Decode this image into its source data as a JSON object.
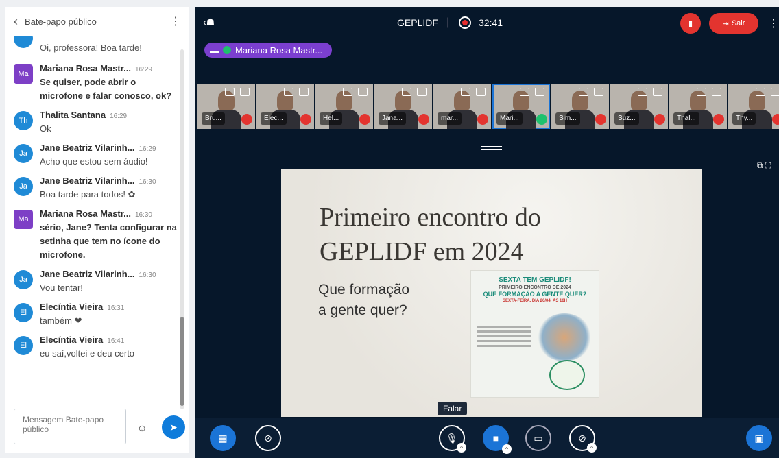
{
  "chat": {
    "title": "Bate-papo público",
    "partial_message": "Oi, professora! Boa tarde!",
    "messages": [
      {
        "initials": "Ma",
        "author": "Mariana Rosa Mastr...",
        "time": "16:29",
        "text": "Se quiser, pode abrir o microfone e falar conosco, ok?",
        "color": "#7d3fc6",
        "square": true,
        "bold": true
      },
      {
        "initials": "Th",
        "author": "Thalita Santana",
        "time": "16:29",
        "text": "Ok",
        "color": "#1f8ad6",
        "square": false,
        "bold": false
      },
      {
        "initials": "Ja",
        "author": "Jane Beatriz Vilarinh...",
        "time": "16:29",
        "text": "Acho que estou sem áudio!",
        "color": "#1f8ad6",
        "square": false,
        "bold": false
      },
      {
        "initials": "Ja",
        "author": "Jane Beatriz Vilarinh...",
        "time": "16:30",
        "text": "Boa tarde para todos! ✿",
        "color": "#1f8ad6",
        "square": false,
        "bold": false
      },
      {
        "initials": "Ma",
        "author": "Mariana Rosa Mastr...",
        "time": "16:30",
        "text": "sério, Jane? Tenta configurar na setinha que tem no ícone do microfone.",
        "color": "#7d3fc6",
        "square": true,
        "bold": true
      },
      {
        "initials": "Ja",
        "author": "Jane Beatriz Vilarinh...",
        "time": "16:30",
        "text": "Vou tentar!",
        "color": "#1f8ad6",
        "square": false,
        "bold": false
      },
      {
        "initials": "El",
        "author": "Elecíntia Vieira",
        "time": "16:31",
        "text": "também ❤",
        "color": "#1f8ad6",
        "square": false,
        "bold": false
      },
      {
        "initials": "El",
        "author": "Elecíntia Vieira",
        "time": "16:41",
        "text": "eu saí,voltei e deu certo",
        "color": "#1f8ad6",
        "square": false,
        "bold": false
      }
    ],
    "input_placeholder": "Mensagem Bate-papo público"
  },
  "meeting": {
    "title": "GEPLIDF",
    "timer": "32:41",
    "leave_label": "Sair",
    "talking": "Mariana Rosa Mastr...",
    "participants": [
      {
        "name": "Bru...",
        "mic_on": false,
        "active": false
      },
      {
        "name": "Elec...",
        "mic_on": false,
        "active": false
      },
      {
        "name": "Hel...",
        "mic_on": false,
        "active": false
      },
      {
        "name": "Jana...",
        "mic_on": false,
        "active": false
      },
      {
        "name": "mar...",
        "mic_on": false,
        "active": false
      },
      {
        "name": "Mari...",
        "mic_on": true,
        "active": true
      },
      {
        "name": "Sim...",
        "mic_on": false,
        "active": false
      },
      {
        "name": "Suz...",
        "mic_on": false,
        "active": false
      },
      {
        "name": "Thal...",
        "mic_on": false,
        "active": false
      },
      {
        "name": "Thy...",
        "mic_on": false,
        "active": false
      }
    ]
  },
  "slide": {
    "title_line1": "Primeiro encontro do",
    "title_line2": "GEPLIDF em 2024",
    "subtitle_line1": "Que formação",
    "subtitle_line2": "a gente quer?",
    "poster_heading": "SEXTA TEM GEPLIDF!",
    "poster_line1": "PRIMEIRO ENCONTRO DE 2024",
    "poster_line2": "QUE FORMAÇÃO A GENTE QUER?",
    "poster_line3": "SEXTA-FEIRA, DIA 26/04, ÀS 16H"
  },
  "controls": {
    "tooltip": "Falar"
  }
}
